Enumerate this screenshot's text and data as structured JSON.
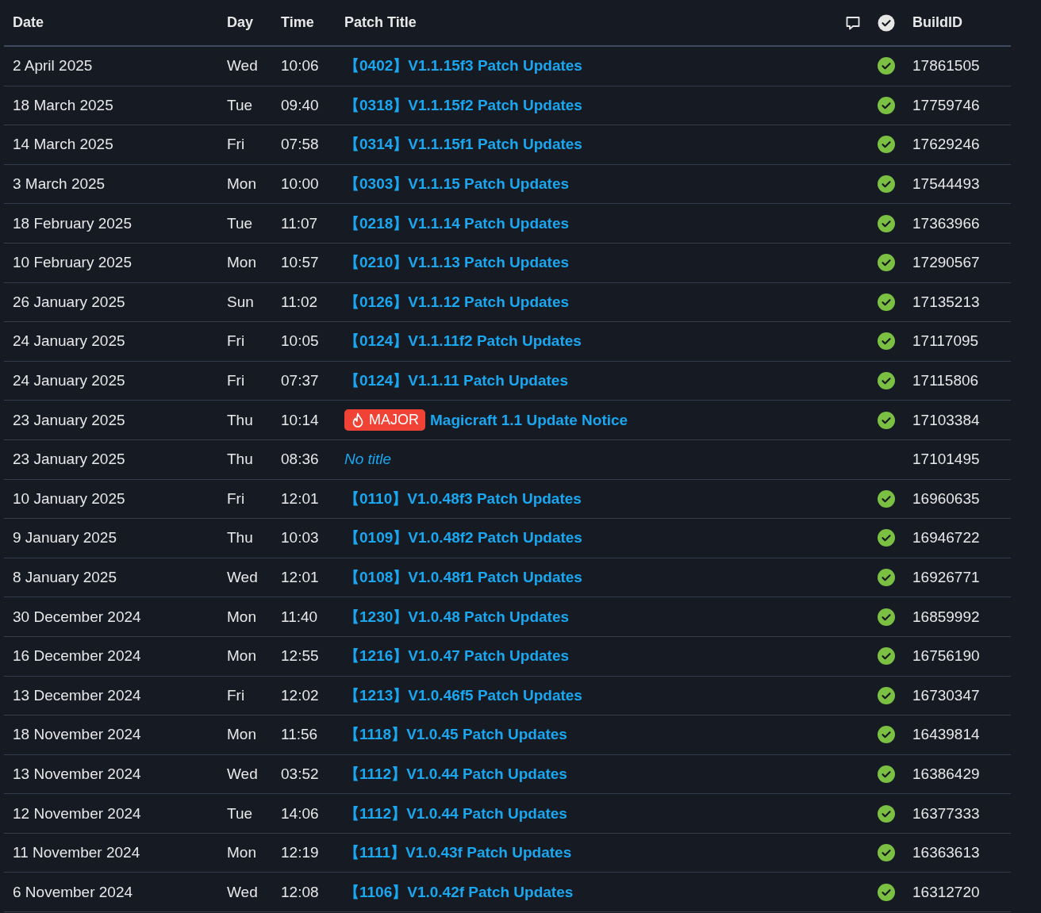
{
  "columns": {
    "date": "Date",
    "day": "Day",
    "time": "Time",
    "title": "Patch Title",
    "build": "BuildID"
  },
  "rows": [
    {
      "date": "2 April 2025",
      "day": "Wed",
      "time": "10:06",
      "kind": "patch",
      "title": "【0402】V1.1.15f3 Patch Updates",
      "verified": true,
      "build": "17861505"
    },
    {
      "date": "18 March 2025",
      "day": "Tue",
      "time": "09:40",
      "kind": "patch",
      "title": "【0318】V1.1.15f2 Patch Updates",
      "verified": true,
      "build": "17759746"
    },
    {
      "date": "14 March 2025",
      "day": "Fri",
      "time": "07:58",
      "kind": "patch",
      "title": "【0314】V1.1.15f1 Patch Updates",
      "verified": true,
      "build": "17629246"
    },
    {
      "date": "3 March 2025",
      "day": "Mon",
      "time": "10:00",
      "kind": "patch",
      "title": "【0303】V1.1.15 Patch Updates",
      "verified": true,
      "build": "17544493"
    },
    {
      "date": "18 February 2025",
      "day": "Tue",
      "time": "11:07",
      "kind": "patch",
      "title": "【0218】V1.1.14 Patch Updates",
      "verified": true,
      "build": "17363966"
    },
    {
      "date": "10 February 2025",
      "day": "Mon",
      "time": "10:57",
      "kind": "patch",
      "title": "【0210】V1.1.13 Patch Updates",
      "verified": true,
      "build": "17290567"
    },
    {
      "date": "26 January 2025",
      "day": "Sun",
      "time": "11:02",
      "kind": "patch",
      "title": "【0126】V1.1.12 Patch Updates",
      "verified": true,
      "build": "17135213"
    },
    {
      "date": "24 January 2025",
      "day": "Fri",
      "time": "10:05",
      "kind": "patch",
      "title": "【0124】V1.1.11f2 Patch Updates",
      "verified": true,
      "build": "17117095"
    },
    {
      "date": "24 January 2025",
      "day": "Fri",
      "time": "07:37",
      "kind": "patch",
      "title": "【0124】V1.1.11 Patch Updates",
      "verified": true,
      "build": "17115806"
    },
    {
      "date": "23 January 2025",
      "day": "Thu",
      "time": "10:14",
      "kind": "major",
      "badge": "MAJOR",
      "title": "Magicraft 1.1 Update Notice",
      "verified": true,
      "build": "17103384"
    },
    {
      "date": "23 January 2025",
      "day": "Thu",
      "time": "08:36",
      "kind": "untitled",
      "title": "No title",
      "verified": false,
      "build": "17101495"
    },
    {
      "date": "10 January 2025",
      "day": "Fri",
      "time": "12:01",
      "kind": "patch",
      "title": "【0110】V1.0.48f3 Patch Updates",
      "verified": true,
      "build": "16960635"
    },
    {
      "date": "9 January 2025",
      "day": "Thu",
      "time": "10:03",
      "kind": "patch",
      "title": "【0109】V1.0.48f2 Patch Updates",
      "verified": true,
      "build": "16946722"
    },
    {
      "date": "8 January 2025",
      "day": "Wed",
      "time": "12:01",
      "kind": "patch",
      "title": "【0108】V1.0.48f1 Patch Updates",
      "verified": true,
      "build": "16926771"
    },
    {
      "date": "30 December 2024",
      "day": "Mon",
      "time": "11:40",
      "kind": "patch",
      "title": "【1230】V1.0.48 Patch Updates",
      "verified": true,
      "build": "16859992"
    },
    {
      "date": "16 December 2024",
      "day": "Mon",
      "time": "12:55",
      "kind": "patch",
      "title": "【1216】V1.0.47 Patch Updates",
      "verified": true,
      "build": "16756190"
    },
    {
      "date": "13 December 2024",
      "day": "Fri",
      "time": "12:02",
      "kind": "patch",
      "title": "【1213】V1.0.46f5 Patch Updates",
      "verified": true,
      "build": "16730347"
    },
    {
      "date": "18 November 2024",
      "day": "Mon",
      "time": "11:56",
      "kind": "patch",
      "title": "【1118】V1.0.45 Patch Updates",
      "verified": true,
      "build": "16439814"
    },
    {
      "date": "13 November 2024",
      "day": "Wed",
      "time": "03:52",
      "kind": "patch",
      "title": "【1112】V1.0.44 Patch Updates",
      "verified": true,
      "build": "16386429"
    },
    {
      "date": "12 November 2024",
      "day": "Tue",
      "time": "14:06",
      "kind": "patch",
      "title": "【1112】V1.0.44 Patch Updates",
      "verified": true,
      "build": "16377333"
    },
    {
      "date": "11 November 2024",
      "day": "Mon",
      "time": "12:19",
      "kind": "patch",
      "title": "【1111】V1.0.43f Patch Updates",
      "verified": true,
      "build": "16363613"
    },
    {
      "date": "6 November 2024",
      "day": "Wed",
      "time": "12:08",
      "kind": "patch",
      "title": "【1106】V1.0.42f Patch Updates",
      "verified": true,
      "build": "16312720"
    }
  ]
}
